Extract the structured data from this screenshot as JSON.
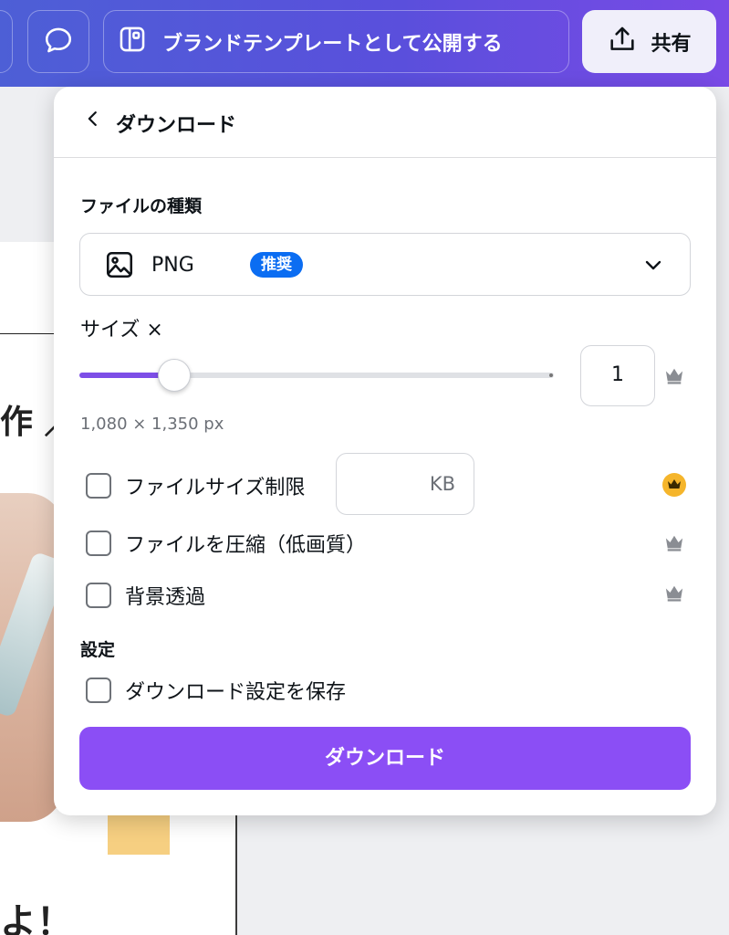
{
  "topbar": {
    "brand_template_label": "ブランドテンプレートとして公開する",
    "share_label": "共有"
  },
  "canvas": {
    "text_line1": "作 ／",
    "text_line2": "よ！"
  },
  "panel": {
    "title": "ダウンロード",
    "file_type": {
      "section_label": "ファイルの種類",
      "selected": "PNG",
      "badge": "推奨"
    },
    "size": {
      "label": "サイズ ×",
      "value": "1",
      "slider_fraction": 0.2,
      "dimensions": "1,080 × 1,350 px"
    },
    "options": [
      {
        "label": "ファイルサイズ制限",
        "checked": false
      },
      {
        "label": "ファイルを圧縮（低画質）",
        "checked": false
      },
      {
        "label": "背景透過",
        "checked": false
      }
    ],
    "file_size_unit": "KB",
    "settings": {
      "section_label": "設定",
      "save_settings_label": "ダウンロード設定を保存"
    },
    "download_button": "ダウンロード"
  },
  "colors": {
    "accent": "#8b4ef5",
    "badge": "#0b6df2",
    "crown_gold": "#f5b52b",
    "crown_gray": "#8a8d93"
  },
  "icons": [
    "comment-icon",
    "brand-template-icon",
    "share-icon",
    "back-chevron-icon",
    "image-icon",
    "chevron-down-icon",
    "crown-icon"
  ]
}
